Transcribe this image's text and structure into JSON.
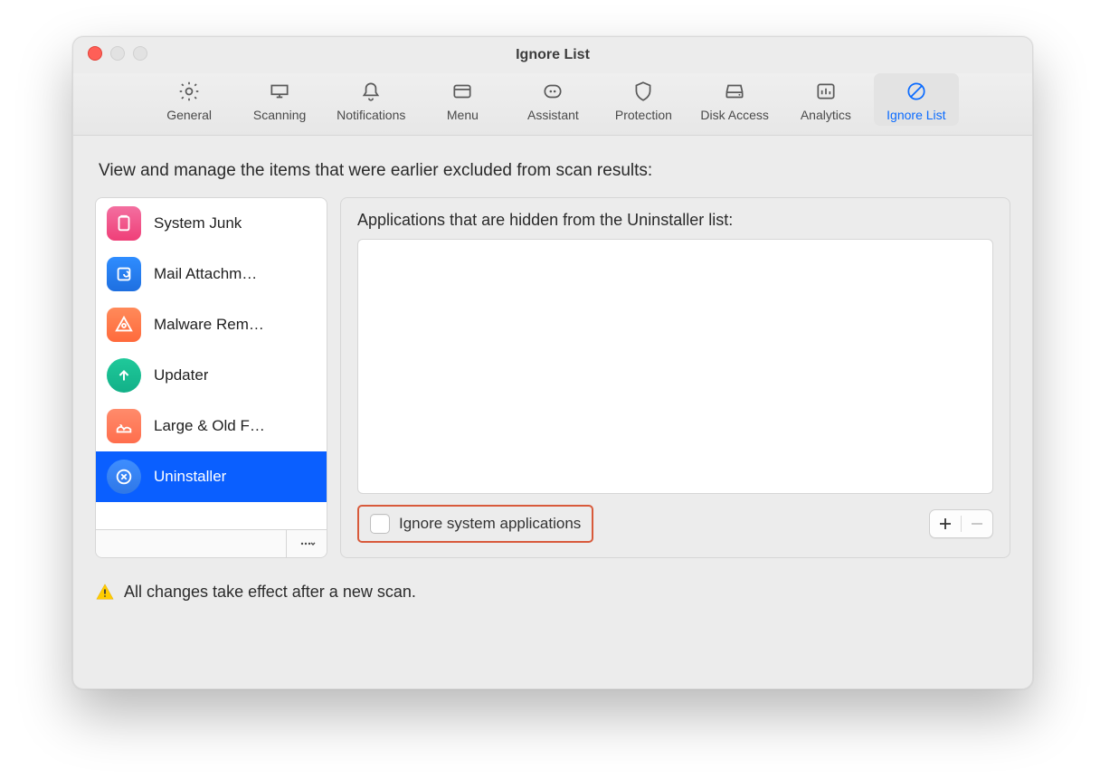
{
  "window": {
    "title": "Ignore List"
  },
  "toolbar": {
    "tabs": [
      {
        "id": "general",
        "label": "General"
      },
      {
        "id": "scanning",
        "label": "Scanning"
      },
      {
        "id": "notifications",
        "label": "Notifications"
      },
      {
        "id": "menu",
        "label": "Menu"
      },
      {
        "id": "assistant",
        "label": "Assistant"
      },
      {
        "id": "protection",
        "label": "Protection"
      },
      {
        "id": "disk-access",
        "label": "Disk Access"
      },
      {
        "id": "analytics",
        "label": "Analytics"
      },
      {
        "id": "ignore-list",
        "label": "Ignore List",
        "active": true
      }
    ]
  },
  "content": {
    "intro": "View and manage the items that were earlier excluded from scan results:"
  },
  "sidebar": {
    "filter_value": "",
    "items": [
      {
        "id": "system-junk",
        "label": "System Junk",
        "icon": "system-junk-icon",
        "selected": false
      },
      {
        "id": "mail-attachments",
        "label": "Mail Attachm…",
        "icon": "mail-attachments-icon",
        "selected": false
      },
      {
        "id": "malware-removal",
        "label": "Malware Rem…",
        "icon": "malware-icon",
        "selected": false
      },
      {
        "id": "updater",
        "label": "Updater",
        "icon": "updater-icon",
        "selected": false
      },
      {
        "id": "large-old-files",
        "label": "Large & Old F…",
        "icon": "large-files-icon",
        "selected": false
      },
      {
        "id": "uninstaller",
        "label": "Uninstaller",
        "icon": "uninstaller-icon",
        "selected": true
      }
    ]
  },
  "panel": {
    "title": "Applications that are hidden from the Uninstaller list:",
    "items": [],
    "checkbox_label": "Ignore system applications",
    "checkbox_checked": false,
    "highlighted": true,
    "remove_enabled": false
  },
  "footer": {
    "text": "All changes take effect after a new scan."
  },
  "colors": {
    "accent_blue": "#0a6bff",
    "selection_blue": "#0a5fff",
    "highlight_red": "#d85a3b"
  }
}
